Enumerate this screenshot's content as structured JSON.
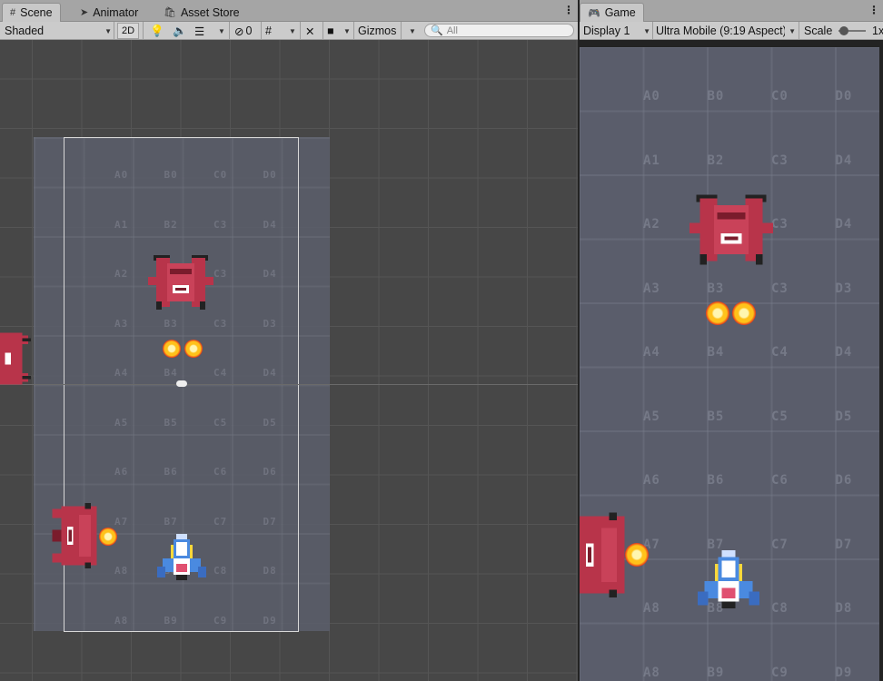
{
  "scene_tabs": [
    {
      "label": "Scene",
      "icon": "grid-icon"
    },
    {
      "label": "Animator",
      "icon": "animator-icon"
    },
    {
      "label": "Asset Store",
      "icon": "store-bag-icon"
    }
  ],
  "scene_toolbar": {
    "draw_mode": "Shaded",
    "toggle_2d": "2D",
    "hidden_count": "0",
    "gizmos": "Gizmos",
    "search_placeholder": "All"
  },
  "game_tab": {
    "label": "Game",
    "icon": "gamepad-icon"
  },
  "game_toolbar": {
    "display": "Display 1",
    "aspect": "Ultra Mobile (9:19 Aspect)",
    "scale_label": "Scale",
    "scale_value": "1x"
  },
  "grid_labels_scene": [
    [
      "A0",
      "B0",
      "C0",
      "D0"
    ],
    [
      "A1",
      "B2",
      "C3",
      "D4"
    ],
    [
      "A2",
      "B3",
      "C3",
      "D4"
    ],
    [
      "A3",
      "B3",
      "C3",
      "D3"
    ],
    [
      "A4",
      "B4",
      "C4",
      "D4"
    ],
    [
      "A5",
      "B5",
      "C5",
      "D5"
    ],
    [
      "A6",
      "B6",
      "C6",
      "D6"
    ],
    [
      "A7",
      "B7",
      "C7",
      "D7"
    ],
    [
      "A8",
      "B8",
      "C8",
      "D8"
    ],
    [
      "A8",
      "B9",
      "C9",
      "D9"
    ]
  ],
  "grid_labels_game": [
    [
      "A0",
      "B0",
      "C0",
      "D0"
    ],
    [
      "A1",
      "B2",
      "C3",
      "D4"
    ],
    [
      "A2",
      "B3",
      "C3",
      "D4"
    ],
    [
      "A3",
      "B3",
      "C3",
      "D3"
    ],
    [
      "A4",
      "B4",
      "C4",
      "D4"
    ],
    [
      "A5",
      "B5",
      "C5",
      "D5"
    ],
    [
      "A6",
      "B6",
      "C6",
      "D6"
    ],
    [
      "A7",
      "B7",
      "C7",
      "D7"
    ],
    [
      "A8",
      "B8",
      "C8",
      "D8"
    ],
    [
      "A8",
      "B9",
      "C9",
      "D9"
    ]
  ],
  "colors": {
    "enemy_red": "#b8344a",
    "enemy_dark": "#7a1c2c",
    "player_blue": "#4a8ae0",
    "bullet_orange": "#ffc21a"
  }
}
